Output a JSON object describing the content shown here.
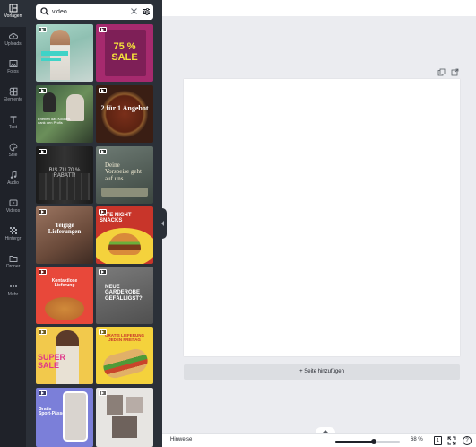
{
  "sidebar": {
    "items": [
      {
        "label": "Vorlagen",
        "icon": "templates-icon"
      },
      {
        "label": "Uploads",
        "icon": "upload-cloud-icon"
      },
      {
        "label": "Fotos",
        "icon": "photo-icon"
      },
      {
        "label": "Elemente",
        "icon": "shapes-icon"
      },
      {
        "label": "Text",
        "icon": "text-icon"
      },
      {
        "label": "Stile",
        "icon": "palette-icon"
      },
      {
        "label": "Audio",
        "icon": "music-note-icon"
      },
      {
        "label": "Videos",
        "icon": "video-icon"
      },
      {
        "label": "Hintergr",
        "icon": "background-grid-icon"
      },
      {
        "label": "Ordner",
        "icon": "folder-icon"
      },
      {
        "label": "Mehr",
        "icon": "more-dots-icon"
      }
    ]
  },
  "search": {
    "value": "video",
    "placeholder": ""
  },
  "templates": [
    {
      "title": "",
      "icon": "video-badge-icon"
    },
    {
      "title": "75 % SALE",
      "icon": "video-badge-icon"
    },
    {
      "title": "Erleben das Kochen, dank den Profis",
      "icon": "video-badge-icon"
    },
    {
      "title": "2 für 1 Angebot",
      "icon": "video-badge-icon"
    },
    {
      "title": "BIS ZU 70 % RABATT!",
      "icon": "video-badge-icon"
    },
    {
      "title": "Deine Vorspeise geht auf uns",
      "icon": "video-badge-icon"
    },
    {
      "title": "Teigige Lieferungen",
      "icon": "video-badge-icon"
    },
    {
      "title": "LATE NIGHT SNACKS",
      "icon": "video-badge-icon"
    },
    {
      "title": "Kontaktlose Lieferung",
      "icon": "video-badge-icon"
    },
    {
      "title": "NEUE GARDEROBE GEFÄLLIGST?",
      "icon": "video-badge-icon"
    },
    {
      "title": "SUPER SALE",
      "icon": "video-badge-icon"
    },
    {
      "title": "GRATIS LIEFERUNG JEDEN FREITAG",
      "icon": "video-badge-icon"
    },
    {
      "title": "Gratis Sport-Pässe",
      "icon": "video-badge-icon"
    },
    {
      "title": "",
      "icon": "video-badge-icon"
    }
  ],
  "canvas": {
    "add_page_label": "+ Seite hinzufügen"
  },
  "footer": {
    "hints_label": "Hinweise",
    "zoom_label": "68 %",
    "zoom_value": 0.68,
    "page_number": "1",
    "help_label": "?"
  },
  "colors": {
    "rail_bg": "#1f2229",
    "panel_bg": "#2b3038",
    "workspace_bg": "#ebecf0",
    "accent": "#00c4cc"
  }
}
